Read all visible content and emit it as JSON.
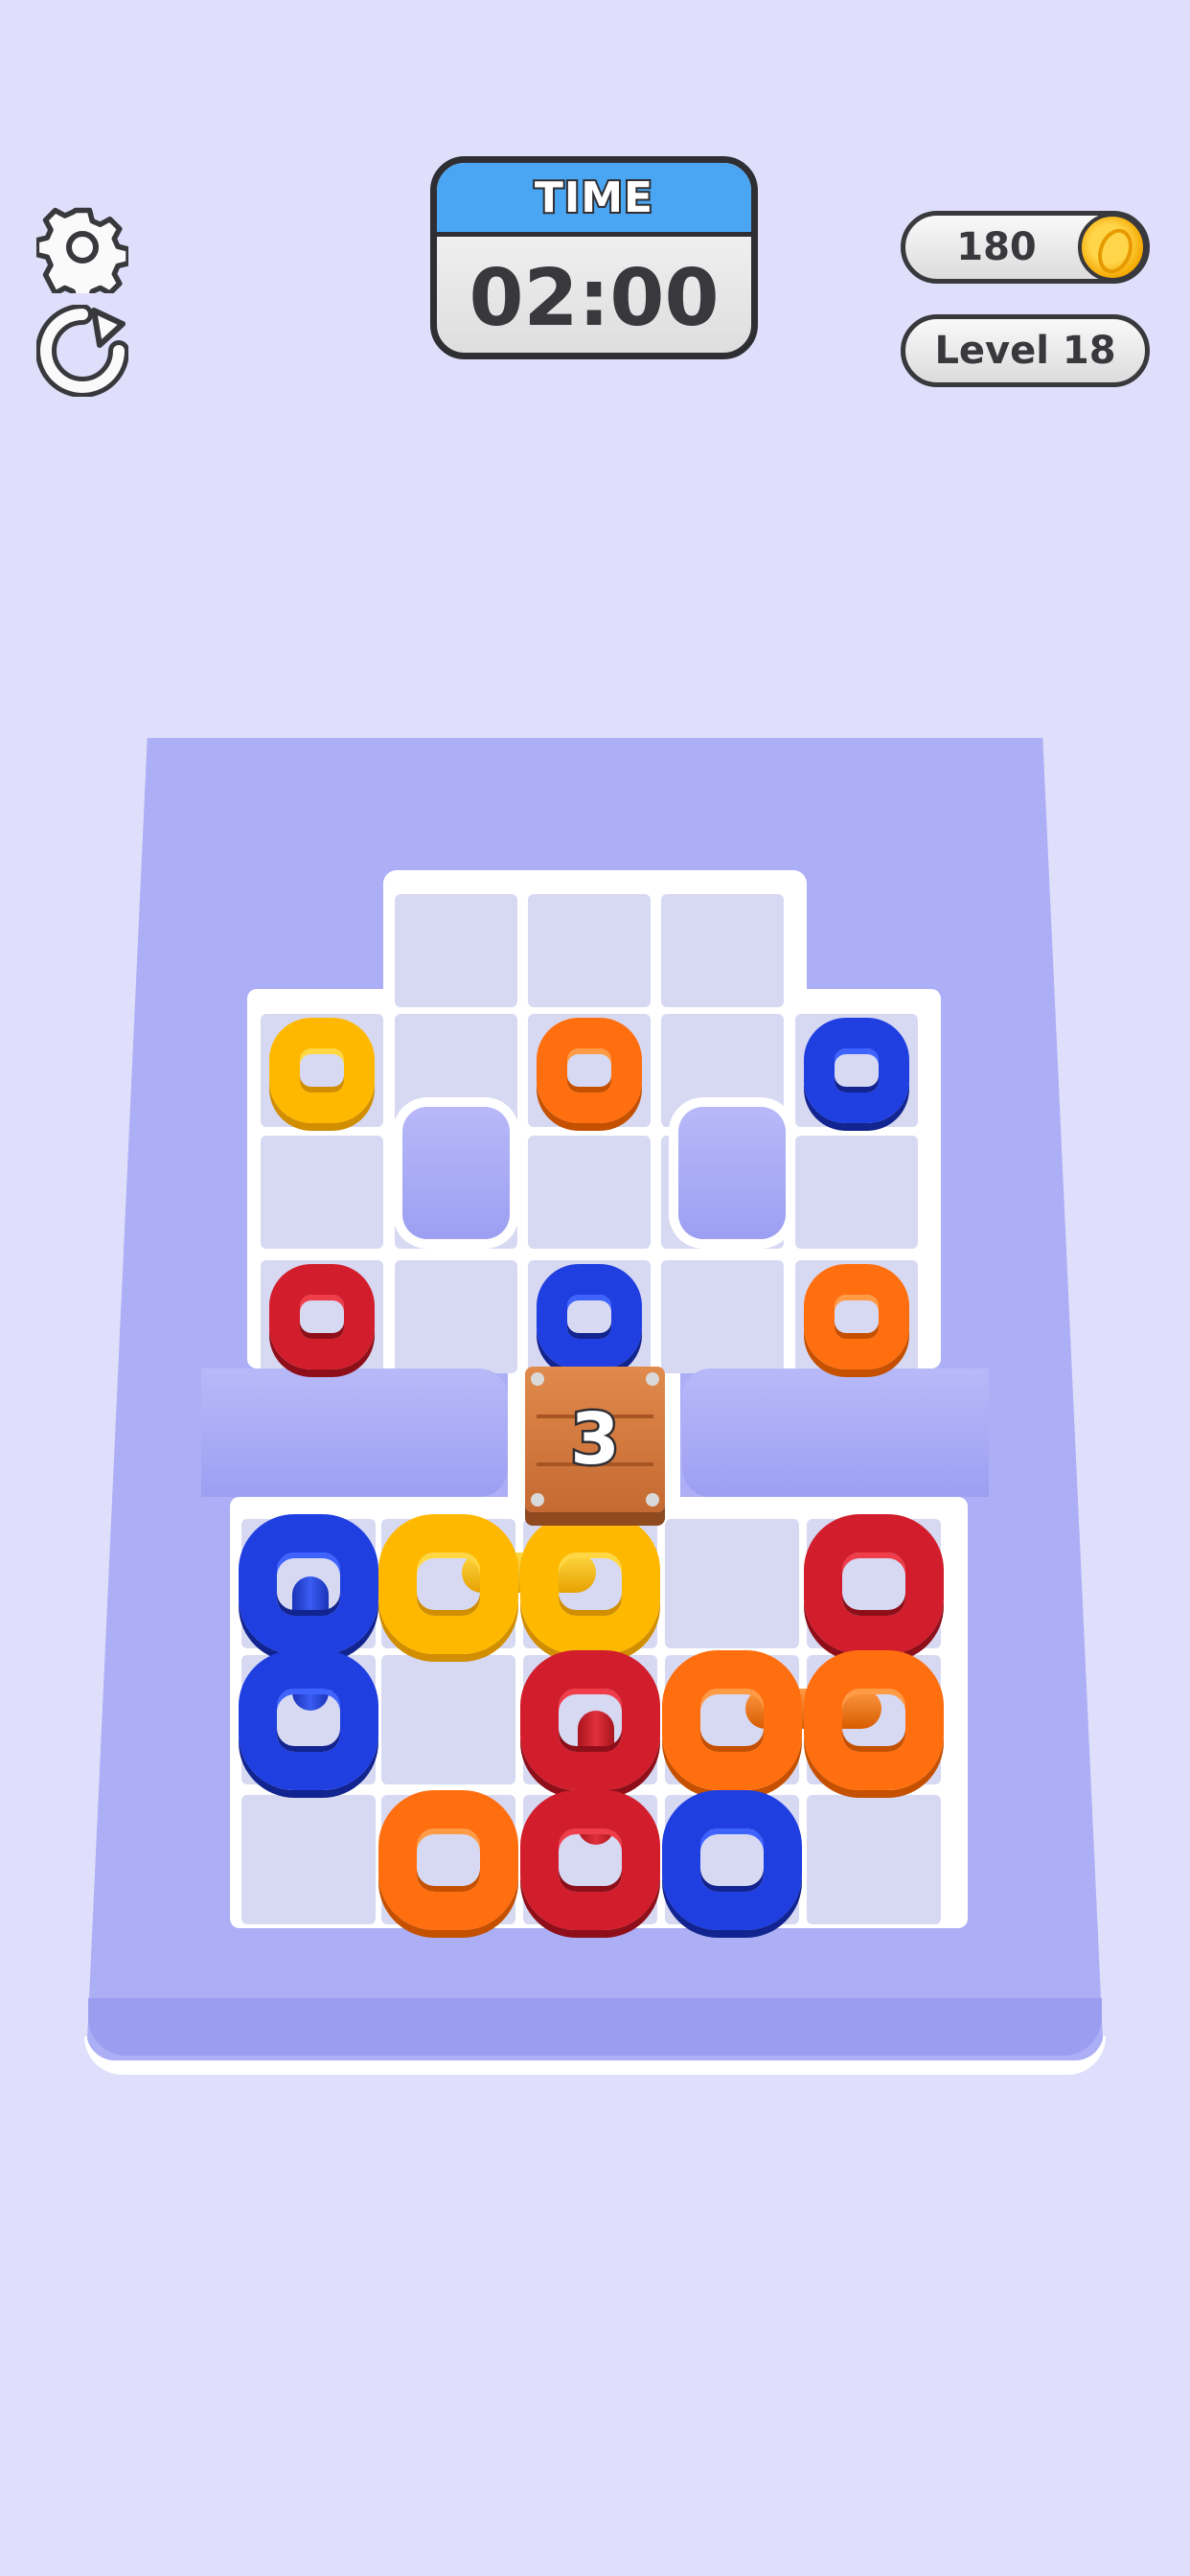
{
  "hud": {
    "settings_icon": "gear-icon",
    "restart_icon": "restart-icon",
    "timer_label": "TIME",
    "timer_value": "02:00",
    "coins": "180",
    "coin_icon": "coin-icon",
    "level": "Level 18"
  },
  "crate": {
    "count": "3"
  },
  "colors": {
    "background": "#dfdffb",
    "board": "#acaef6",
    "yellow": "#ffc10a",
    "orange": "#ff7a1a",
    "blue": "#1f3fe0",
    "red": "#d6202f",
    "timer_header": "#4aa6f2"
  },
  "rings": [
    {
      "color": "yellow",
      "row": 1,
      "col": 0
    },
    {
      "color": "orange",
      "row": 1,
      "col": 2
    },
    {
      "color": "blue",
      "row": 1,
      "col": 4
    },
    {
      "color": "red",
      "row": 3,
      "col": 0
    },
    {
      "color": "blue",
      "row": 3,
      "col": 2
    },
    {
      "color": "orange",
      "row": 3,
      "col": 4
    },
    {
      "color": "blue",
      "row": 4,
      "col": 0
    },
    {
      "color": "yellow",
      "row": 4,
      "col": 1
    },
    {
      "color": "yellow",
      "row": 4,
      "col": 2
    },
    {
      "color": "red",
      "row": 4,
      "col": 4
    },
    {
      "color": "blue",
      "row": 5,
      "col": 0
    },
    {
      "color": "red",
      "row": 5,
      "col": 2
    },
    {
      "color": "orange",
      "row": 5,
      "col": 3
    },
    {
      "color": "orange",
      "row": 5,
      "col": 4
    },
    {
      "color": "orange",
      "row": 6,
      "col": 1
    },
    {
      "color": "red",
      "row": 6,
      "col": 2
    },
    {
      "color": "blue",
      "row": 6,
      "col": 3
    }
  ]
}
